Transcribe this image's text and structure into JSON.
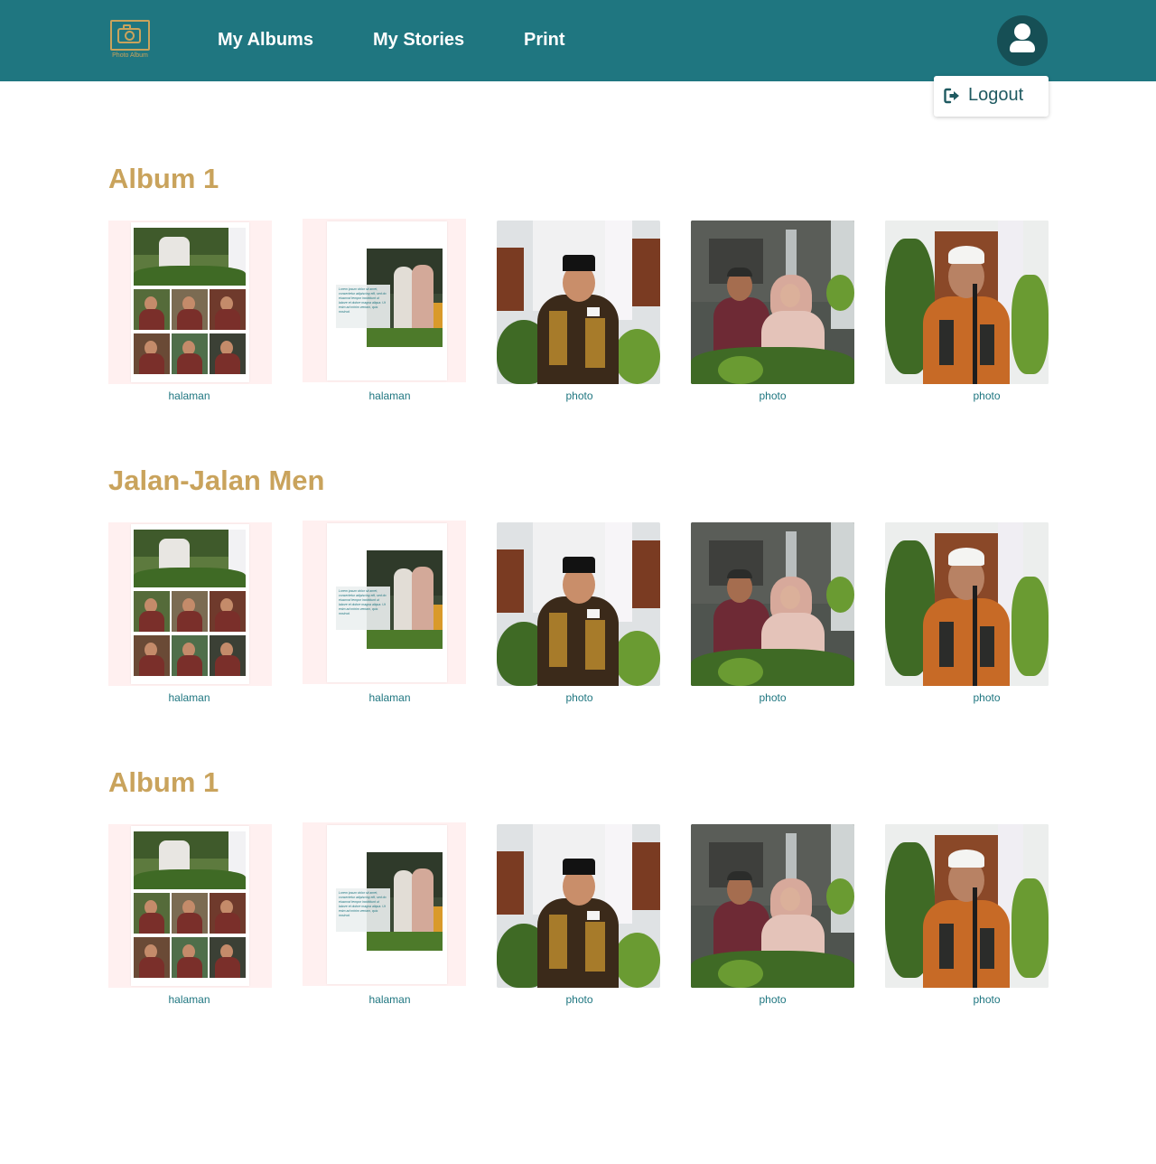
{
  "header": {
    "logo_text": "Photo Album",
    "nav": [
      {
        "label": "My Albums"
      },
      {
        "label": "My Stories"
      },
      {
        "label": "Print"
      }
    ]
  },
  "user_menu": {
    "logout_label": "Logout"
  },
  "albums": [
    {
      "title": "Album 1",
      "items": [
        {
          "type": "page-collage",
          "caption": "halaman"
        },
        {
          "type": "page-story",
          "caption": "halaman",
          "story_text": "Lorem ipsum dolor sit amet, consectetur adipiscing elit, sed do eiusmod tempor incididunt ut labore et dolore magna aliqua. Ut enim ad minim veniam, quis nostrud."
        },
        {
          "type": "photo-speaker",
          "caption": "photo"
        },
        {
          "type": "photo-couple",
          "caption": "photo"
        },
        {
          "type": "photo-elder",
          "caption": "photo"
        }
      ]
    },
    {
      "title": "Jalan-Jalan Men",
      "items": [
        {
          "type": "page-collage",
          "caption": "halaman"
        },
        {
          "type": "page-story",
          "caption": "halaman",
          "story_text": "Lorem ipsum dolor sit amet, consectetur adipiscing elit, sed do eiusmod tempor incididunt ut labore et dolore magna aliqua. Ut enim ad minim veniam, quis nostrud."
        },
        {
          "type": "photo-speaker",
          "caption": "photo"
        },
        {
          "type": "photo-couple",
          "caption": "photo"
        },
        {
          "type": "photo-elder",
          "caption": "photo"
        }
      ]
    },
    {
      "title": "Album 1",
      "items": [
        {
          "type": "page-collage",
          "caption": "halaman"
        },
        {
          "type": "page-story",
          "caption": "halaman",
          "story_text": "Lorem ipsum dolor sit amet, consectetur adipiscing elit, sed do eiusmod tempor incididunt ut labore et dolore magna aliqua. Ut enim ad minim veniam, quis nostrud."
        },
        {
          "type": "photo-speaker",
          "caption": "photo"
        },
        {
          "type": "photo-couple",
          "caption": "photo"
        },
        {
          "type": "photo-elder",
          "caption": "photo"
        }
      ]
    }
  ],
  "colors": {
    "header_bg": "#1f7680",
    "accent_gold": "#c9a35c",
    "avatar_bg": "#164f55",
    "caption": "#1f7680",
    "page_bg": "#fff0f0"
  },
  "icons": {
    "logo": "camera-frame-icon",
    "avatar": "user-icon",
    "logout": "sign-out-icon"
  }
}
